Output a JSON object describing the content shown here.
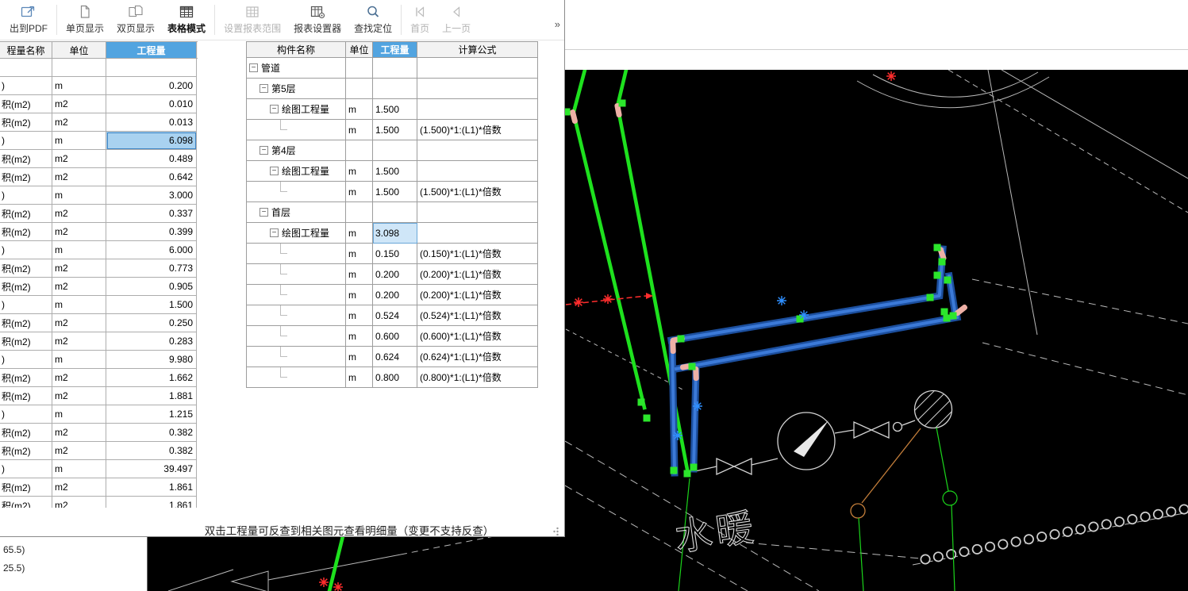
{
  "report_window": {
    "accent_blue": "#52a4e0",
    "selection_fill": "#a9d2f0",
    "toolbar": {
      "overflow_chevron": "»",
      "items": [
        {
          "label": "出到PDF",
          "icon": "export-pdf-icon",
          "state": "enabled"
        },
        {
          "label": "单页显示",
          "icon": "single-page-icon",
          "state": "enabled"
        },
        {
          "label": "双页显示",
          "icon": "double-page-icon",
          "state": "enabled"
        },
        {
          "label": "表格模式",
          "icon": "table-mode-icon",
          "state": "active"
        },
        {
          "label": "设置报表范围",
          "icon": "report-range-icon",
          "state": "disabled"
        },
        {
          "label": "报表设置器",
          "icon": "report-designer-icon",
          "state": "enabled"
        },
        {
          "label": "查找定位",
          "icon": "find-locate-icon",
          "state": "enabled"
        },
        {
          "label": "首页",
          "icon": "first-page-icon",
          "state": "disabled"
        },
        {
          "label": "上一页",
          "icon": "prev-page-icon",
          "state": "disabled"
        }
      ]
    },
    "quantity_table": {
      "headers": [
        "程量名称",
        "单位",
        "工程量"
      ],
      "rows": [
        {
          "name": "",
          "unit": "",
          "value": ""
        },
        {
          "name": ")",
          "unit": "m",
          "value": "0.200"
        },
        {
          "name": "积(m2)",
          "unit": "m2",
          "value": "0.010"
        },
        {
          "name": "积(m2)",
          "unit": "m2",
          "value": "0.013"
        },
        {
          "name": ")",
          "unit": "m",
          "value": "6.098",
          "selected": true
        },
        {
          "name": "积(m2)",
          "unit": "m2",
          "value": "0.489"
        },
        {
          "name": "积(m2)",
          "unit": "m2",
          "value": "0.642"
        },
        {
          "name": ")",
          "unit": "m",
          "value": "3.000"
        },
        {
          "name": "积(m2)",
          "unit": "m2",
          "value": "0.337"
        },
        {
          "name": "积(m2)",
          "unit": "m2",
          "value": "0.399"
        },
        {
          "name": ")",
          "unit": "m",
          "value": "6.000"
        },
        {
          "name": "积(m2)",
          "unit": "m2",
          "value": "0.773"
        },
        {
          "name": "积(m2)",
          "unit": "m2",
          "value": "0.905"
        },
        {
          "name": ")",
          "unit": "m",
          "value": "1.500"
        },
        {
          "name": "积(m2)",
          "unit": "m2",
          "value": "0.250"
        },
        {
          "name": "积(m2)",
          "unit": "m2",
          "value": "0.283"
        },
        {
          "name": ")",
          "unit": "m",
          "value": "9.980"
        },
        {
          "name": "积(m2)",
          "unit": "m2",
          "value": "1.662"
        },
        {
          "name": "积(m2)",
          "unit": "m2",
          "value": "1.881"
        },
        {
          "name": ")",
          "unit": "m",
          "value": "1.215"
        },
        {
          "name": "积(m2)",
          "unit": "m2",
          "value": "0.382"
        },
        {
          "name": "积(m2)",
          "unit": "m2",
          "value": "0.382"
        },
        {
          "name": ")",
          "unit": "m",
          "value": "39.497"
        },
        {
          "name": "积(m2)",
          "unit": "m2",
          "value": "1.861"
        },
        {
          "name": "积(m2)",
          "unit": "m2",
          "value": "1.861"
        }
      ]
    },
    "component_table": {
      "headers": [
        "构件名称",
        "单位",
        "工程量",
        "计算公式"
      ],
      "collapse_glyph": "−",
      "rows": [
        {
          "level": 0,
          "expander": true,
          "name": "管道"
        },
        {
          "level": 1,
          "expander": true,
          "name": "第5层"
        },
        {
          "level": 2,
          "expander": true,
          "name": "绘图工程量",
          "unit": "m",
          "qty": "1.500"
        },
        {
          "level": 3,
          "unit": "m",
          "qty": "1.500",
          "formula": "(1.500)*1:(L1)*倍数"
        },
        {
          "level": 1,
          "expander": true,
          "name": "第4层"
        },
        {
          "level": 2,
          "expander": true,
          "name": "绘图工程量",
          "unit": "m",
          "qty": "1.500"
        },
        {
          "level": 3,
          "unit": "m",
          "qty": "1.500",
          "formula": "(1.500)*1:(L1)*倍数"
        },
        {
          "level": 1,
          "expander": true,
          "name": "首层"
        },
        {
          "level": 2,
          "expander": true,
          "name": "绘图工程量",
          "unit": "m",
          "qty": "3.098",
          "selected": true
        },
        {
          "level": 3,
          "unit": "m",
          "qty": "0.150",
          "formula": "(0.150)*1:(L1)*倍数"
        },
        {
          "level": 3,
          "unit": "m",
          "qty": "0.200",
          "formula": "(0.200)*1:(L1)*倍数"
        },
        {
          "level": 3,
          "unit": "m",
          "qty": "0.200",
          "formula": "(0.200)*1:(L1)*倍数"
        },
        {
          "level": 3,
          "unit": "m",
          "qty": "0.524",
          "formula": "(0.524)*1:(L1)*倍数"
        },
        {
          "level": 3,
          "unit": "m",
          "qty": "0.600",
          "formula": "(0.600)*1:(L1)*倍数"
        },
        {
          "level": 3,
          "unit": "m",
          "qty": "0.624",
          "formula": "(0.624)*1:(L1)*倍数"
        },
        {
          "level": 3,
          "unit": "m",
          "qty": "0.800",
          "formula": "(0.800)*1:(L1)*倍数"
        }
      ]
    },
    "status_bar": {
      "message": "双击工程量可反查到相关图元查看明细量（变更不支持反查）"
    }
  },
  "background_panel": {
    "items": [
      "65.5)",
      "25.5)"
    ]
  },
  "cad": {
    "text_label": "水暖",
    "colors": {
      "background": "#000000",
      "pipe_green": "#1ee11e",
      "pipe_blue_dark": "#1c4f9e",
      "pipe_blue_light": "#3c7ad8",
      "fitting_pink": "#eeb0a6",
      "grip_green": "#2ce62c",
      "linework_white": "#c4c4c4",
      "marker_red": "#ff2d2d",
      "marker_blue": "#2f8fff",
      "accent_orange": "#c27d3a"
    }
  }
}
